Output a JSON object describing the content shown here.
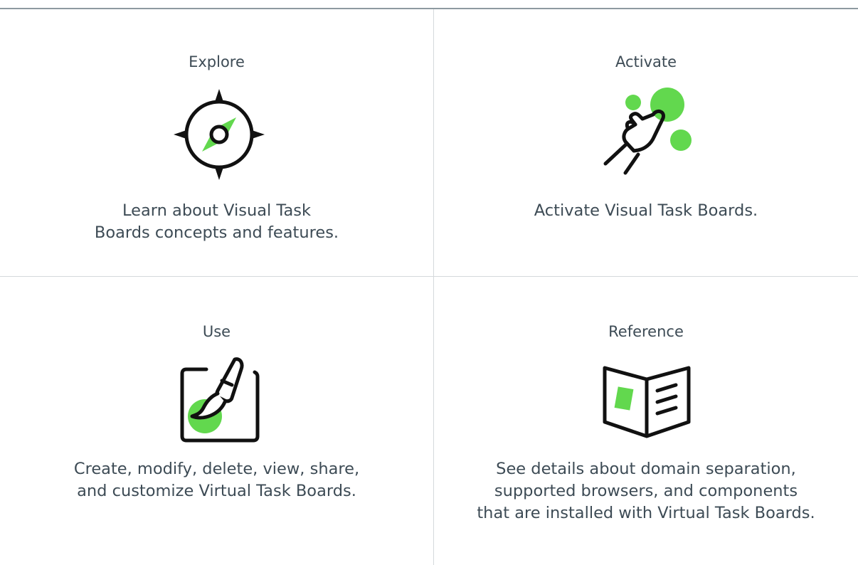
{
  "cards": {
    "explore": {
      "title": "Explore",
      "icon": "compass-icon",
      "desc_lines": [
        "Learn about Visual Task",
        "Boards concepts and features."
      ]
    },
    "activate": {
      "title": "Activate",
      "icon": "hand-tap-icon",
      "desc_lines": [
        "Activate Visual Task Boards."
      ]
    },
    "use": {
      "title": "Use",
      "icon": "paintbrush-icon",
      "desc_lines": [
        "Create, modify, delete, view, share,",
        "and customize Virtual Task Boards."
      ]
    },
    "reference": {
      "title": "Reference",
      "icon": "open-book-icon",
      "desc_lines": [
        "See details about domain separation,",
        "supported browsers, and components",
        "that are installed with Virtual Task Boards."
      ]
    }
  },
  "colors": {
    "accent": "#62d84e",
    "icon_stroke": "#1a1a1a",
    "text": "#3d4b55",
    "divider": "#d5d9dc",
    "top_rule": "#8e9aa0"
  }
}
